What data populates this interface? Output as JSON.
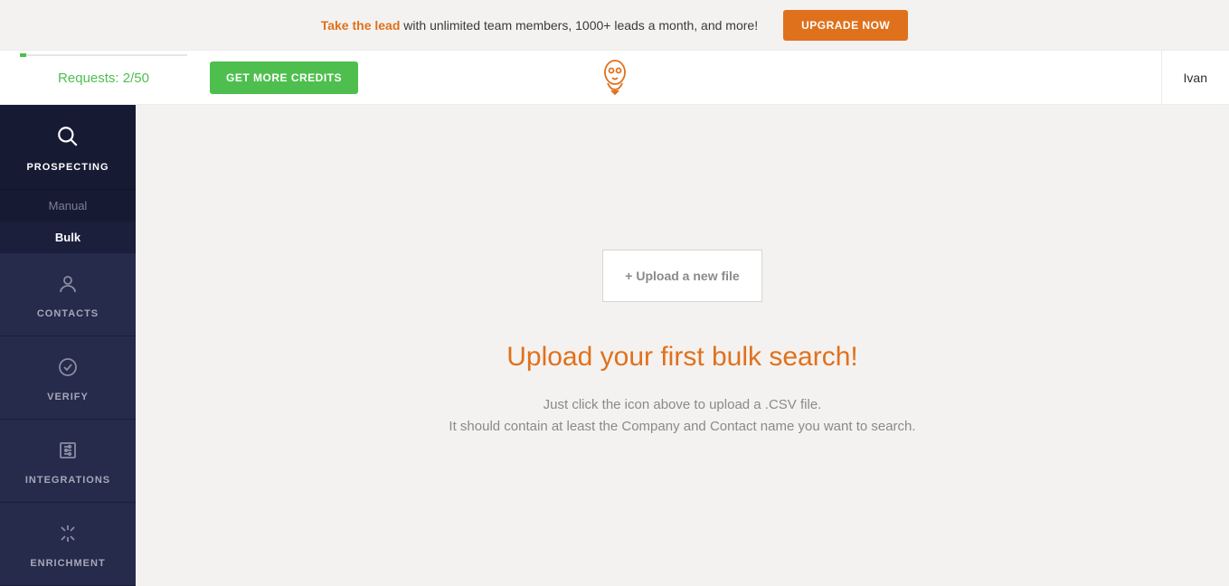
{
  "promo": {
    "lead": "Take the lead",
    "rest": " with unlimited team members, 1000+ leads a month, and more!",
    "button": "UPGRADE NOW"
  },
  "topbar": {
    "requests_label": "Requests: 2/50",
    "credits_button": "GET MORE CREDITS",
    "user_name": "Ivan"
  },
  "sidebar": {
    "items": [
      {
        "label": "PROSPECTING",
        "sub": [
          {
            "label": "Manual"
          },
          {
            "label": "Bulk"
          }
        ]
      },
      {
        "label": "CONTACTS"
      },
      {
        "label": "VERIFY"
      },
      {
        "label": "INTEGRATIONS"
      },
      {
        "label": "ENRICHMENT"
      }
    ]
  },
  "content": {
    "upload_button": "+ Upload a new file",
    "headline": "Upload your first bulk search!",
    "sub_line1": "Just click the icon above to upload a .CSV file.",
    "sub_line2": "It should contain at least the Company and Contact name you want to search."
  }
}
